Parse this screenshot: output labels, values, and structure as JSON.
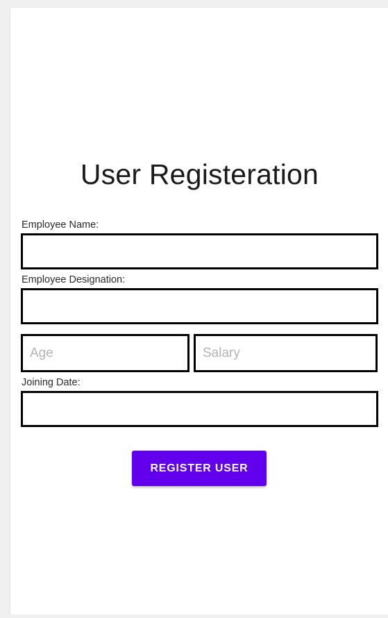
{
  "form": {
    "title": "User Registeration",
    "employee_name_label": "Employee Name:",
    "employee_name_value": "",
    "employee_designation_label": "Employee Designation:",
    "employee_designation_value": "",
    "age_placeholder": "Age",
    "salary_placeholder": "Salary",
    "joining_date_label": "Joining Date:",
    "joining_date_value": "",
    "register_button_label": "REGISTER USER"
  },
  "colors": {
    "button_background": "#6200ee",
    "button_text": "#ffffff",
    "field_border": "#000000",
    "placeholder": "#b4b4b4"
  }
}
